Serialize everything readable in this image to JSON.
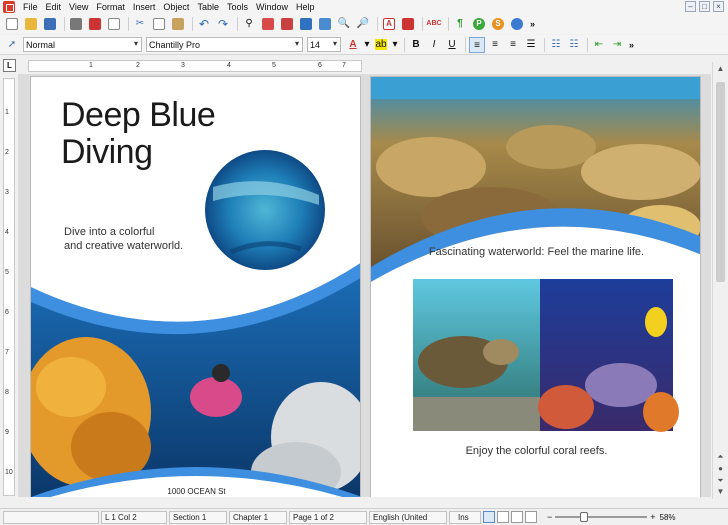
{
  "menu": {
    "items": [
      "File",
      "Edit",
      "View",
      "Format",
      "Insert",
      "Object",
      "Table",
      "Tools",
      "Window",
      "Help"
    ]
  },
  "window_controls": {
    "minimize": "–",
    "maximize": "□",
    "close": "×"
  },
  "format_toolbar": {
    "paragraph_style": "Normal",
    "font_name": "Chantilly Pro",
    "font_size": "14",
    "bold": "B",
    "italic": "I",
    "underline": "U",
    "more": "»"
  },
  "ruler": {
    "corner_label": "L",
    "h_numbers": [
      "1",
      "2",
      "3",
      "4",
      "5",
      "6",
      "7"
    ],
    "v_numbers": [
      "1",
      "2",
      "3",
      "4",
      "5",
      "6",
      "7",
      "8",
      "9",
      "10"
    ]
  },
  "document": {
    "page1": {
      "title_line1": "Deep Blue",
      "title_line2": "Diving",
      "subtitle_line1": "Dive into a colorful",
      "subtitle_line2": "and creative waterworld.",
      "address": "1000 OCEAN St"
    },
    "page2": {
      "caption_top": "Fascinating waterworld: Feel the marine life.",
      "caption_bottom": "Enjoy the colorful coral reefs."
    }
  },
  "status": {
    "position": "L 1 Col 2",
    "section": "Section 1",
    "chapter": "Chapter 1",
    "page": "Page 1 of 2",
    "language": "English (United",
    "mode": "Ins",
    "zoom": "58%",
    "zoom_minus": "−",
    "zoom_plus": "+"
  },
  "colors": {
    "accent_blue": "#3f8fe0",
    "ocean_deep": "#1d5f9e",
    "coral_orange": "#e39a2a"
  }
}
